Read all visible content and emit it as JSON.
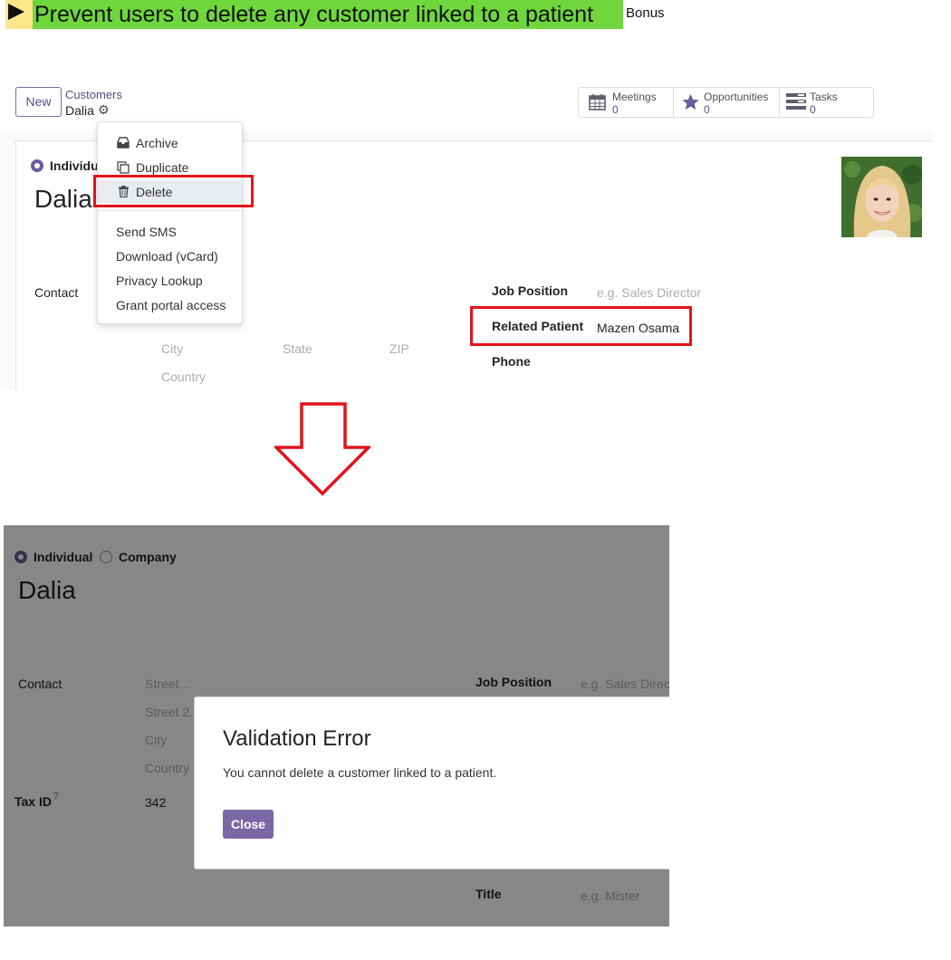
{
  "header": {
    "title": "Prevent users to delete any customer linked to a patient",
    "bonus": "Bonus"
  },
  "top": {
    "new_button": "New",
    "breadcrumb": "Customers",
    "record_name": "Dalia",
    "smart_buttons": [
      {
        "label": "Meetings",
        "count": "0",
        "icon": "calendar-icon"
      },
      {
        "label": "Opportunities",
        "count": "0",
        "icon": "star-icon"
      },
      {
        "label": "Tasks",
        "count": "0",
        "icon": "tasks-icon"
      }
    ],
    "menu": {
      "archive": "Archive",
      "duplicate": "Duplicate",
      "delete": "Delete",
      "send_sms": "Send SMS",
      "download_vcard": "Download (vCard)",
      "privacy_lookup": "Privacy Lookup",
      "grant_portal": "Grant portal access"
    },
    "form": {
      "type_individual": "Individual",
      "name": "Dalia",
      "contact_label": "Contact",
      "city_ph": "City",
      "state_ph": "State",
      "zip_ph": "ZIP",
      "country_ph": "Country",
      "job_position_label": "Job Position",
      "job_position_ph": "e.g. Sales Director",
      "related_patient_label": "Related Patient",
      "related_patient_value": "Mazen Osama",
      "phone_label": "Phone"
    }
  },
  "bottom": {
    "type_individual": "Individual",
    "type_company": "Company",
    "name": "Dalia",
    "contact_label": "Contact",
    "street_ph": "Street...",
    "street2_ph": "Street 2...",
    "city_ph": "City",
    "country_ph": "Country",
    "tax_id_label": "Tax ID",
    "tax_id_help": "?",
    "tax_id_value": "342",
    "job_position_label": "Job Position",
    "job_position_ph": "e.g. Sales Director",
    "title_label": "Title",
    "title_ph": "e.g. Mister",
    "dialog": {
      "title": "Validation Error",
      "message": "You cannot delete a customer linked to a patient.",
      "close": "Close"
    }
  },
  "colors": {
    "brand": "#714b67",
    "accent_purple": "#7b68a6",
    "highlight_green": "#6fd63c",
    "highlight_yellow": "#fde78d",
    "annotation_red": "#e3131c"
  }
}
